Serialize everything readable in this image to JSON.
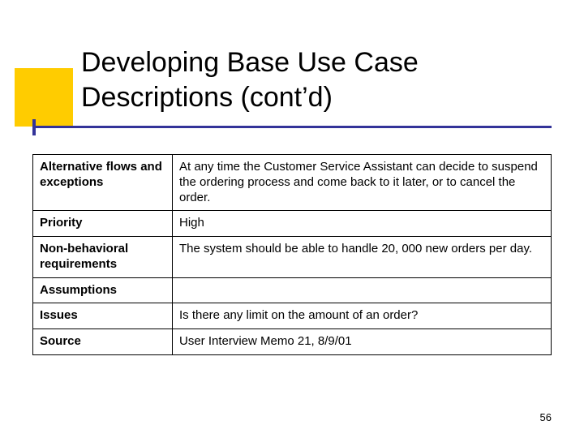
{
  "slide": {
    "title_line1": "Developing Base Use Case",
    "title_line2": "Descriptions (cont’d)",
    "page_number": "56"
  },
  "rows": {
    "r0": {
      "label": "Alternative flows and exceptions",
      "value": "At any time the Customer Service Assistant can decide to suspend the ordering process and come back to it later, or to cancel the order."
    },
    "r1": {
      "label": "Priority",
      "value": "High"
    },
    "r2": {
      "label": "Non-behavioral requirements",
      "value": "The system should be able to handle 20, 000 new orders per day."
    },
    "r3": {
      "label": "Assumptions",
      "value": ""
    },
    "r4": {
      "label": "Issues",
      "value": "Is there any limit on the amount of an order?"
    },
    "r5": {
      "label": "Source",
      "value": "User Interview Memo 21, 8/9/01"
    }
  }
}
